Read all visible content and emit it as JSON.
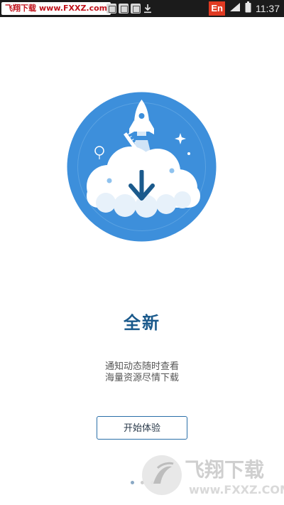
{
  "status_bar": {
    "watermark_site": "飞翔下载",
    "watermark_url": "www.FXXZ.com",
    "lang_badge": "En",
    "time": "11:37",
    "icons": [
      "notification-icon",
      "notification-icon",
      "notification-icon",
      "download-icon",
      "signal-icon",
      "battery-icon"
    ]
  },
  "intro": {
    "title": "全新",
    "line1": "通知动态随时查看",
    "line2": "海量资源尽情下载",
    "start_button": "开始体验"
  },
  "pager": {
    "count": 3,
    "active_index": 0
  },
  "watermark": {
    "brand": "飞翔下载",
    "url": "www.FXXZ.COM"
  },
  "colors": {
    "circle": "#3d8fdb",
    "cloud": "#ffffff",
    "arrow": "#1b5a8c",
    "title": "#1b5a8c",
    "button_border": "#2a6fa8"
  }
}
